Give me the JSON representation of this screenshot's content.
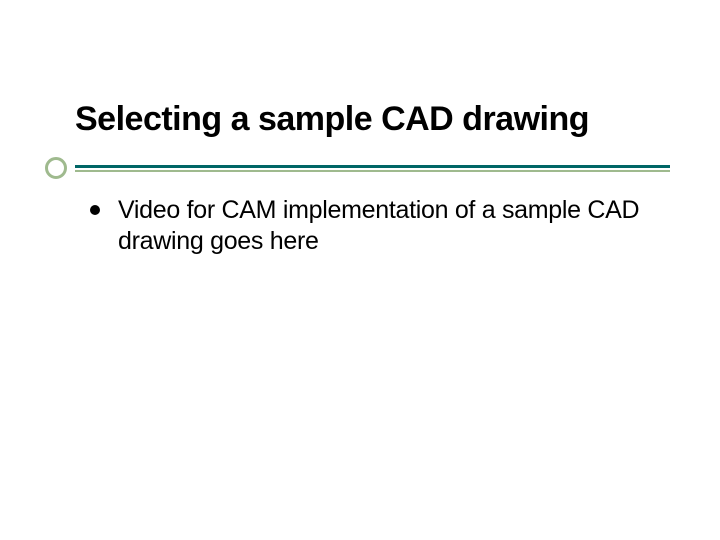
{
  "slide": {
    "title": "Selecting a sample CAD drawing",
    "bullets": [
      {
        "text": "Video for CAM implementation of a sample CAD drawing goes here"
      }
    ]
  },
  "colors": {
    "accent_teal": "#006666",
    "accent_green": "#9fba8e"
  }
}
